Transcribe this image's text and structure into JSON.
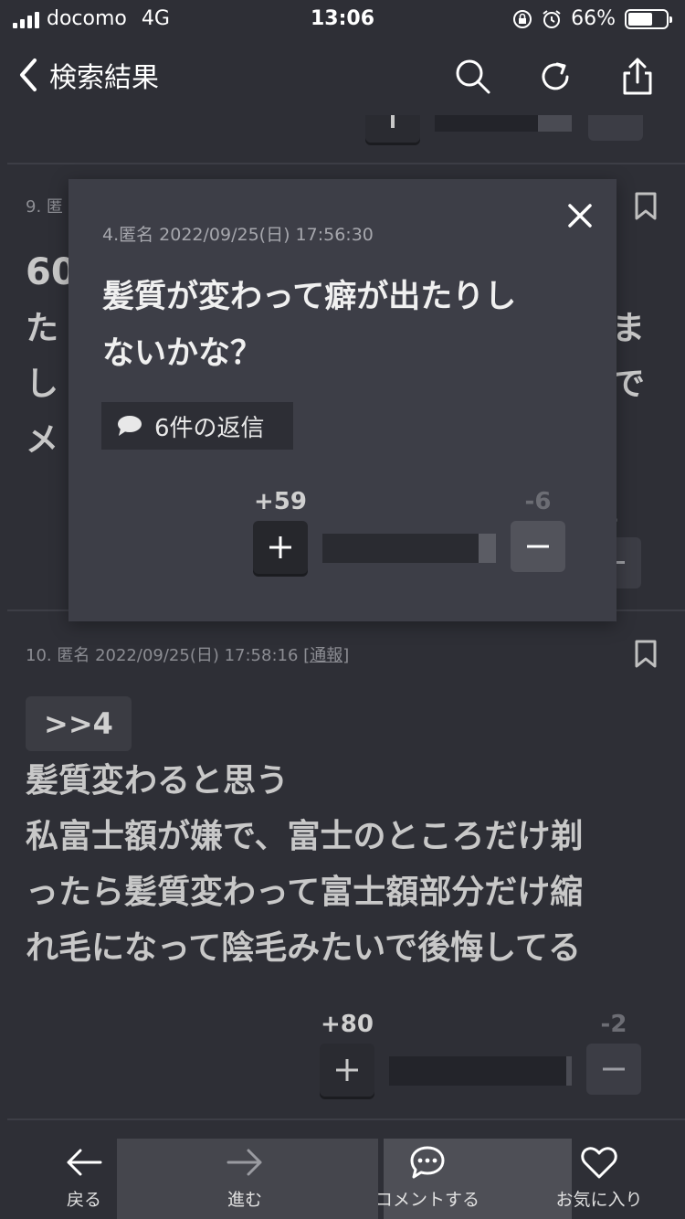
{
  "status": {
    "carrier": "docomo",
    "network": "4G",
    "time": "13:06",
    "battery": "66%",
    "battery_level": 0.66
  },
  "nav": {
    "title": "検索結果",
    "icons": [
      "search-icon",
      "reload-icon",
      "share-icon"
    ]
  },
  "posts": [
    {
      "meta": "9. 匿",
      "line1": "60",
      "line2": "た",
      "line2_right": "ま",
      "line3": "し",
      "line3_right": "で",
      "line4": "メ",
      "minus_partial": "4"
    },
    {
      "meta": "10. 匿名 2022/09/25(日) 17:58:16",
      "report": "[通報]",
      "quote": ">>4",
      "lines": [
        "髪質変わると思う",
        "私富士額が嫌で、富士のところだけ剃",
        "ったら髪質変わって富士額部分だけ縮",
        "れ毛になって陰毛みたいで後悔してる"
      ],
      "plus": "+80",
      "minus": "-2",
      "plus_ratio": 0.97
    }
  ],
  "popup": {
    "meta": "4.匿名 2022/09/25(日) 17:56:30",
    "text_lines": [
      "髪質が変わって癖が出たりし",
      "ないかな？"
    ],
    "replies": "6件の返信",
    "plus": "+59",
    "minus": "-6",
    "plus_ratio": 0.9
  },
  "tabbar": {
    "back": "戻る",
    "forward": "進む",
    "comment": "コメントする",
    "favorite": "お気に入り"
  }
}
